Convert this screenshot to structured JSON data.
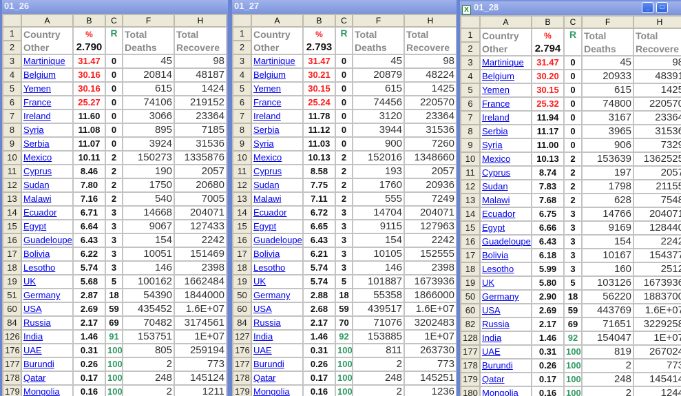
{
  "colors": {
    "red": "#ff1a1a",
    "green": "#2e9a62",
    "link": "#0000ee"
  },
  "columns": [
    "A",
    "B",
    "C",
    "F",
    "H"
  ],
  "headers": {
    "country1": "Country",
    "country2": "Other",
    "pct": "%",
    "r": "R",
    "deaths1": "Total",
    "deaths2": "Deaths",
    "rec1": "Total",
    "rec2": "Recovere"
  },
  "panels": [
    {
      "title": "01_26",
      "total_pct": "2.790",
      "rows": [
        [
          "3",
          "Martinique",
          "31.47",
          "0",
          "45",
          "98"
        ],
        [
          "4",
          "Belgium",
          "30.16",
          "0",
          "20814",
          "48187"
        ],
        [
          "5",
          "Yemen",
          "30.16",
          "0",
          "615",
          "1424"
        ],
        [
          "6",
          "France",
          "25.27",
          "0",
          "74106",
          "219152"
        ],
        [
          "7",
          "Ireland",
          "11.60",
          "0",
          "3066",
          "23364"
        ],
        [
          "8",
          "Syria",
          "11.08",
          "0",
          "895",
          "7185"
        ],
        [
          "9",
          "Serbia",
          "11.07",
          "0",
          "3924",
          "31536"
        ],
        [
          "10",
          "Mexico",
          "10.11",
          "2",
          "150273",
          "1335876"
        ],
        [
          "11",
          "Cyprus",
          "8.46",
          "2",
          "190",
          "2057"
        ],
        [
          "12",
          "Sudan",
          "7.80",
          "2",
          "1750",
          "20680"
        ],
        [
          "13",
          "Malawi",
          "7.16",
          "2",
          "540",
          "7005"
        ],
        [
          "14",
          "Ecuador",
          "6.71",
          "3",
          "14668",
          "204071"
        ],
        [
          "15",
          "Egypt",
          "6.64",
          "3",
          "9067",
          "127433"
        ],
        [
          "16",
          "Guadeloupe",
          "6.43",
          "3",
          "154",
          "2242"
        ],
        [
          "17",
          "Bolivia",
          "6.22",
          "3",
          "10051",
          "151469"
        ],
        [
          "18",
          "Lesotho",
          "5.74",
          "3",
          "146",
          "2398"
        ],
        [
          "19",
          "UK",
          "5.68",
          "5",
          "100162",
          "1662484"
        ],
        [
          "51",
          "Germany",
          "2.87",
          "18",
          "54390",
          "1844000"
        ],
        [
          "60",
          "USA",
          "2.69",
          "59",
          "435452",
          "1.6E+07"
        ],
        [
          "84",
          "Russia",
          "2.17",
          "69",
          "70482",
          "3174561"
        ],
        [
          "126",
          "India",
          "1.46",
          "91",
          "153751",
          "1E+07"
        ],
        [
          "176",
          "UAE",
          "0.31",
          "100",
          "805",
          "259194"
        ],
        [
          "177",
          "Burundi",
          "0.26",
          "100",
          "2",
          "773"
        ],
        [
          "178",
          "Qatar",
          "0.17",
          "100",
          "248",
          "145124"
        ],
        [
          "179",
          "Mongolia",
          "0.16",
          "100",
          "2",
          "1211"
        ]
      ]
    },
    {
      "title": "01_27",
      "total_pct": "2.793",
      "rows": [
        [
          "3",
          "Martinique",
          "31.47",
          "0",
          "45",
          "98"
        ],
        [
          "4",
          "Belgium",
          "30.21",
          "0",
          "20879",
          "48224"
        ],
        [
          "5",
          "Yemen",
          "30.15",
          "0",
          "615",
          "1425"
        ],
        [
          "6",
          "France",
          "25.24",
          "0",
          "74456",
          "220570"
        ],
        [
          "7",
          "Ireland",
          "11.78",
          "0",
          "3120",
          "23364"
        ],
        [
          "8",
          "Serbia",
          "11.12",
          "0",
          "3944",
          "31536"
        ],
        [
          "9",
          "Syria",
          "11.03",
          "0",
          "900",
          "7260"
        ],
        [
          "10",
          "Mexico",
          "10.13",
          "2",
          "152016",
          "1348660"
        ],
        [
          "11",
          "Cyprus",
          "8.58",
          "2",
          "193",
          "2057"
        ],
        [
          "12",
          "Sudan",
          "7.75",
          "2",
          "1760",
          "20936"
        ],
        [
          "13",
          "Malawi",
          "7.11",
          "2",
          "555",
          "7249"
        ],
        [
          "14",
          "Ecuador",
          "6.72",
          "3",
          "14704",
          "204071"
        ],
        [
          "15",
          "Egypt",
          "6.65",
          "3",
          "9115",
          "127963"
        ],
        [
          "16",
          "Guadeloupe",
          "6.43",
          "3",
          "154",
          "2242"
        ],
        [
          "17",
          "Bolivia",
          "6.21",
          "3",
          "10105",
          "152555"
        ],
        [
          "18",
          "Lesotho",
          "5.74",
          "3",
          "146",
          "2398"
        ],
        [
          "19",
          "UK",
          "5.74",
          "5",
          "101887",
          "1673936"
        ],
        [
          "50",
          "Germany",
          "2.88",
          "18",
          "55358",
          "1866000"
        ],
        [
          "60",
          "USA",
          "2.68",
          "59",
          "439517",
          "1.6E+07"
        ],
        [
          "84",
          "Russia",
          "2.17",
          "70",
          "71076",
          "3202483"
        ],
        [
          "127",
          "India",
          "1.46",
          "92",
          "153885",
          "1E+07"
        ],
        [
          "176",
          "UAE",
          "0.31",
          "100",
          "811",
          "263730"
        ],
        [
          "177",
          "Burundi",
          "0.26",
          "100",
          "2",
          "773"
        ],
        [
          "178",
          "Qatar",
          "0.17",
          "100",
          "248",
          "145251"
        ],
        [
          "179",
          "Mongolia",
          "0.16",
          "100",
          "2",
          "1236"
        ]
      ]
    },
    {
      "title": "01_28",
      "total_pct": "2.794",
      "rows": [
        [
          "3",
          "Martinique",
          "31.47",
          "0",
          "45",
          "98"
        ],
        [
          "4",
          "Belgium",
          "30.20",
          "0",
          "20933",
          "48391"
        ],
        [
          "5",
          "Yemen",
          "30.15",
          "0",
          "615",
          "1425"
        ],
        [
          "6",
          "France",
          "25.32",
          "0",
          "74800",
          "220570"
        ],
        [
          "7",
          "Ireland",
          "11.94",
          "0",
          "3167",
          "23364"
        ],
        [
          "8",
          "Serbia",
          "11.17",
          "0",
          "3965",
          "31536"
        ],
        [
          "9",
          "Syria",
          "11.00",
          "0",
          "906",
          "7329"
        ],
        [
          "10",
          "Mexico",
          "10.13",
          "2",
          "153639",
          "1362525"
        ],
        [
          "11",
          "Cyprus",
          "8.74",
          "2",
          "197",
          "2057"
        ],
        [
          "12",
          "Sudan",
          "7.83",
          "2",
          "1798",
          "21155"
        ],
        [
          "13",
          "Malawi",
          "7.68",
          "2",
          "628",
          "7548"
        ],
        [
          "14",
          "Ecuador",
          "6.75",
          "3",
          "14766",
          "204071"
        ],
        [
          "15",
          "Egypt",
          "6.66",
          "3",
          "9169",
          "128440"
        ],
        [
          "16",
          "Guadeloupe",
          "6.43",
          "3",
          "154",
          "2242"
        ],
        [
          "17",
          "Bolivia",
          "6.18",
          "3",
          "10167",
          "154377"
        ],
        [
          "18",
          "Lesotho",
          "5.99",
          "3",
          "160",
          "2512"
        ],
        [
          "19",
          "UK",
          "5.80",
          "5",
          "103126",
          "1673936"
        ],
        [
          "50",
          "Germany",
          "2.90",
          "18",
          "56220",
          "1883700"
        ],
        [
          "60",
          "USA",
          "2.69",
          "59",
          "443769",
          "1.6E+07"
        ],
        [
          "82",
          "Russia",
          "2.17",
          "69",
          "71651",
          "3229258"
        ],
        [
          "128",
          "India",
          "1.46",
          "92",
          "154047",
          "1E+07"
        ],
        [
          "177",
          "UAE",
          "0.31",
          "100",
          "819",
          "267024"
        ],
        [
          "178",
          "Burundi",
          "0.26",
          "100",
          "2",
          "773"
        ],
        [
          "179",
          "Qatar",
          "0.17",
          "100",
          "248",
          "145414"
        ],
        [
          "180",
          "Mongolia",
          "0.16",
          "100",
          "2",
          "1244"
        ]
      ]
    }
  ]
}
